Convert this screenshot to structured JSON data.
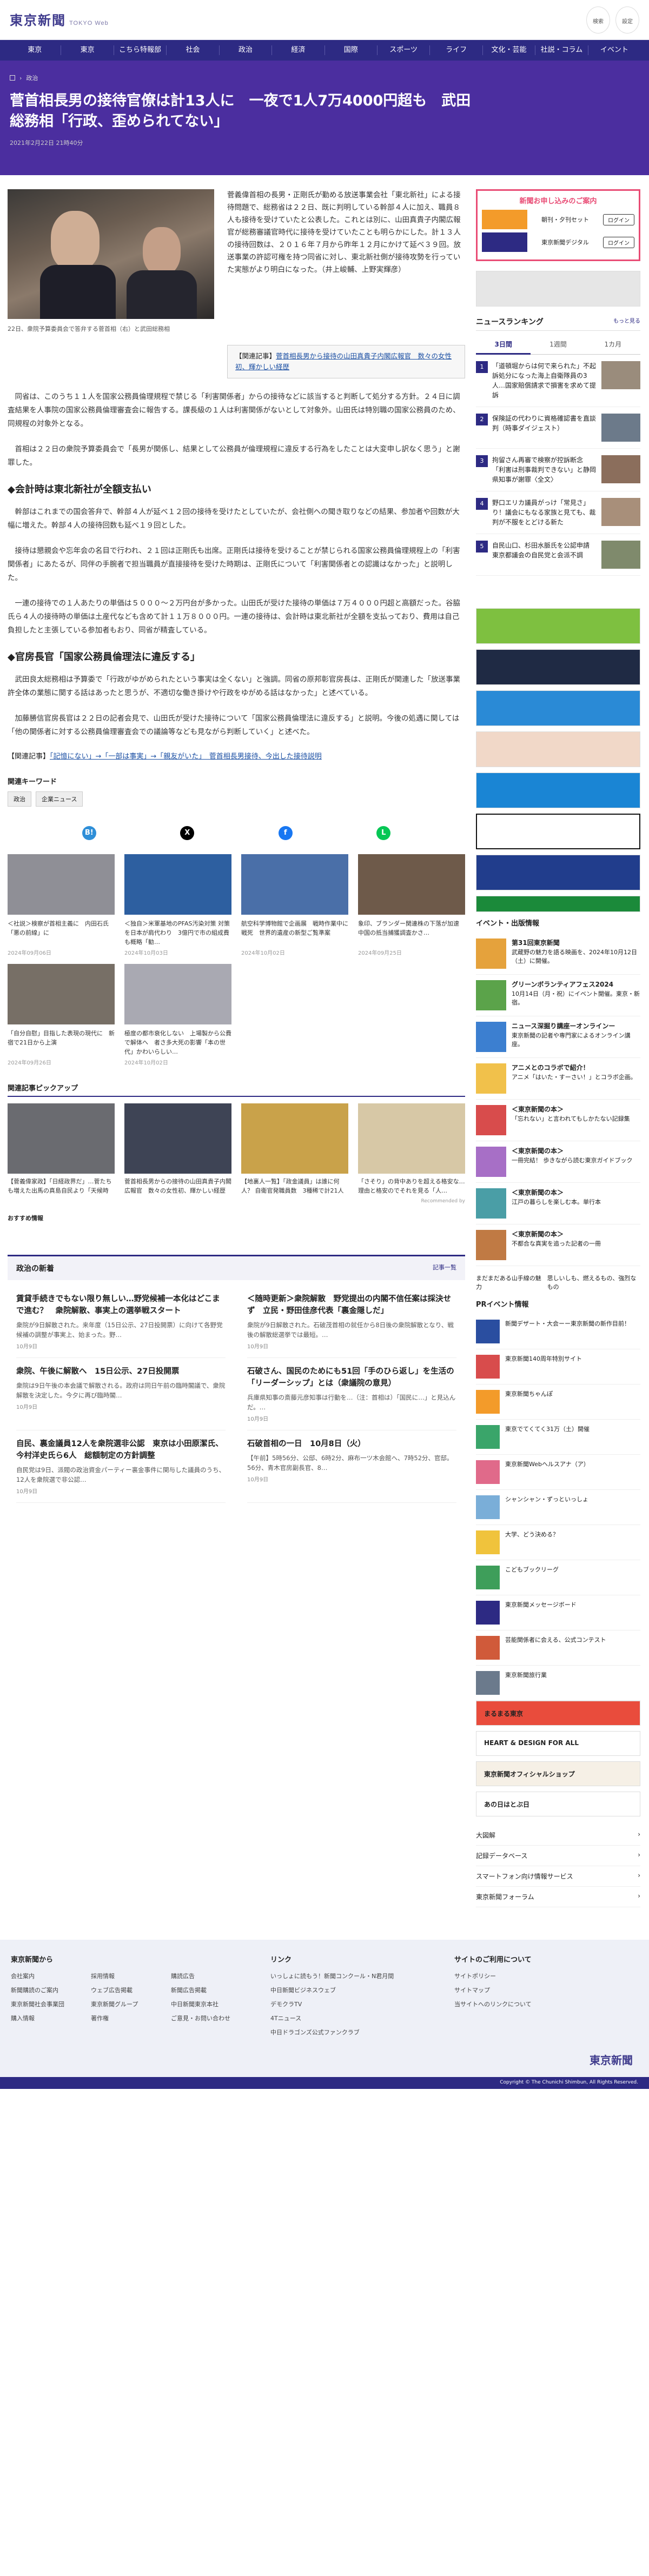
{
  "header": {
    "logo": "東京新聞",
    "logo_sub": "TOKYO Web",
    "btn1": "検索",
    "btn2": "設定"
  },
  "nav": [
    "東京",
    "東京",
    "こちら特報部",
    "社会",
    "政治",
    "経済",
    "国際",
    "スポーツ",
    "ライフ",
    "文化・芸能",
    "社説・コラム",
    "イベント"
  ],
  "hero": {
    "crumb": "政治",
    "title": "菅首相長男の接待官僚は計13人に　一夜で1人7万4000円超も　武田総務相「行政、歪められてない」",
    "date": "2021年2月22日 21時40分"
  },
  "article": {
    "lead": "菅義偉首相の長男・正剛氏が勤める放送事業会社「東北新社」による接待問題で、総務省は２２日、既に判明している幹部４人に加え、職員８人も接待を受けていたと公表した。これとは別に、山田真貴子内閣広報官が総務審議官時代に接待を受けていたことも明らかにした。計１３人の接待回数は、２０１６年７月から昨年１２月にかけて延べ３９回。放送事業の許認可権を持つ同省に対し、東北新社側が接待攻勢を行っていた実態がより明白になった。（井上峻輔、上野実輝彦）",
    "caption": "22日、衆院予算委員会で答弁する菅首相（右）と武田総務相",
    "related_label": "【関連記事】",
    "related_link": "菅首相長男から接待の山田真貴子内閣広報官　数々の女性初、輝かしい経歴",
    "p1": "同省は、このうち１１人を国家公務員倫理規程で禁じる「利害関係者」からの接待などに該当すると判断して処分する方針。２４日に調査結果を人事院の国家公務員倫理審査会に報告する。課長級の１人は利害関係がないとして対象外。山田氏は特別職の国家公務員のため、同規程の対象外となる。",
    "p2": "首相は２２日の衆院予算委員会で「長男が関係し、結果として公務員が倫理規程に違反する行為をしたことは大変申し訳なく思う」と謝罪した。",
    "h1": "◆会計時は東北新社が全額支払い",
    "p3": "幹部はこれまでの国会答弁で、幹部４人が延べ１２回の接待を受けたとしていたが、会社側への聞き取りなどの結果、参加者や回数が大幅に増えた。幹部４人の接待回数も延べ１９回とした。",
    "p4": "接待は懇親会や忘年会の名目で行われ、２１回は正剛氏も出席。正剛氏は接待を受けることが禁じられる国家公務員倫理規程上の「利害関係者」にあたるが、同伴の手腕者で担当職員が直接接待を受けた時期は、正剛氏について「利害関係者との認識はなかった」と説明した。",
    "p5": "一連の接待での１人あたりの単価は５０００〜２万円台が多かった。山田氏が受けた接待の単価は７万４０００円超と高額だった。谷脇氏ら４人の接待時の単価は土産代なども含めて計１１万８０００円。一連の接待は、会計時は東北新社が全額を支払っており、費用は自己負担したと主張している参加者もおり、同省が精査している。",
    "h2": "◆官房長官「国家公務員倫理法に違反する」",
    "p6": "武田良太総務相は予算委で「行政がゆがめられたという事実は全くない」と強調。同省の原邦彰官房長は、正剛氏が関連した「放送事業許全体の業態に関する話はあったと思うが、不適切な働き掛けや行政をゆがめる話はなかった」と述べている。",
    "p7": "加藤勝信官房長官は２２日の記者会見で、山田氏が受けた接待について「国家公務員倫理法に違反する」と説明。今後の処遇に関しては「他の関係者に対する公務員倫理審査会での議論等なども見ながら判断していく」と述べた。",
    "rel2_label": "【関連記事】",
    "rel2_links": "「記憶にない」→「一部は事実」→「親友がいた」　菅首相長男接待、今出した接待説明"
  },
  "keywords": {
    "title": "関連キーワード",
    "tags": [
      "政治",
      "企業ニュース"
    ]
  },
  "share": [
    "B!",
    "X",
    "f",
    "L"
  ],
  "cards": [
    {
      "t": "＜社説＞検察が首相主義に　内田石氏「悪の前線」に",
      "d": "2024年09月06日"
    },
    {
      "t": "＜独自＞米軍基地のPFAS汚染対策 対策を日本が肩代わり　3億円で市の組成費も概略「勧…",
      "d": "2024年10月03日"
    },
    {
      "t": "航空科学博物館で企画展　戦時作業中に戦死　世界的遺産の新型ご覧準案",
      "d": "2024年10月02日"
    },
    {
      "t": "象印、ブランダー関連株の下落が加速　中国の抵当捕獲調査かさ…",
      "d": "2024年09月25日"
    },
    {
      "t": "「自分自慰」目指した表現の現代に　新宿で21日から上演",
      "d": "2024年09月26日"
    },
    {
      "t": "極度の都市衰化しない　上場製から公費で解体へ　者さ多大死の影響「本の世代」かわいらしい…",
      "d": "2024年10月02日"
    }
  ],
  "pickup": {
    "title": "関連記事ピックアップ",
    "items": [
      "【菅義偉家政】「日経政界だ」…菅たちも増えた出馬の真島自民より「天候時代」の政…",
      "菅首相長男からの接待の山田真貴子内閣広報官　数々の女性初、輝かしい経歴",
      "【地裏人一覧】「政金議員」は誰に何人？ 自衛官発職員数　3種稀で計21人　政治改革への…",
      "「さそり」の背中ありを超える格安な…理由と格安のでそれを見る「人…"
    ],
    "credit": "Recommended by"
  },
  "osusume": "おすすめ情報",
  "news": {
    "title": "政治の新着",
    "more": "記事一覧",
    "items": [
      {
        "h": "賃貸手続きでもない限り無しい…野党候補一本化はどこまで進む？　衆院解散、事実上の選挙戦スタート",
        "p": "衆院が9日解散された。来年度（15日公示、27日投開票）に向けて各野党候補の調整が事実上、始まった。野…",
        "d": "10月9日"
      },
      {
        "h": "＜随時更新＞衆院解散　野党提出の内閣不信任案は採決せず　立民・野田佳彦代表「裏金隠しだ」",
        "p": "衆院が9日解散された。石破茂首相の就任から8日後の衆院解散となり、戦後の解散総選挙では最短。…",
        "d": "10月9日"
      },
      {
        "h": "衆院、午後に解散へ　15日公示、27日投開票",
        "p": "衆院は9日午後の本会議で解散される。政府は同日午前の臨時閣議で、衆院解散を決定した。今夕に再び臨時閣…",
        "d": "10月9日"
      },
      {
        "h": "石破さん、国民のためにも51回「手のひら返し」を生活の「リーダーシップ」とは（衆議院の意見）",
        "p": "兵庫県知事の斎藤元彦知事は行動を…（注：首相は）「国民に…」と見込んだ。…",
        "d": "10月9日"
      },
      {
        "h": "自民、裏金議員12人を衆院選非公認　東京は小田原潔氏、今村洋史氏ら6人　総額制定の方針調整",
        "p": "自民党は9日、派閥の政治資金パーティー裏金事件に関与した議員のうち、12人を衆院選で非公認…",
        "d": "10月9日"
      },
      {
        "h": "石破首相の一日　10月8日（火）",
        "p": "【午前】5時56分、公邸、6時2分、麻布一ツ木会館へ、7時52分、官邸。56分、青木官房副長官、8…",
        "d": "10月9日"
      }
    ]
  },
  "sidebar": {
    "subs_title": "新聞お申し込みのご案内",
    "subs": [
      {
        "n": "朝刊・夕刊セット",
        "b": "ログイン"
      },
      {
        "n": "東京新聞デジタル",
        "b": "ログイン"
      }
    ],
    "rank_title": "ニュースランキング",
    "rank_more": "もっと見る",
    "rank_tabs": [
      "3日間",
      "1週間",
      "1カ月"
    ],
    "rank": [
      "「道頓堀からは何で来られた」不起訴処分になった海上自衛隊員の3人…国家賠償請求で損害を求めて提訴",
      "保険証の代わりに資格確認書を直談判（時事ダイジェスト）",
      "拘留さん再審で検察が控訴断念　「利害は刑事裁判できない」と静岡県知事が謝罪〈全文〉",
      "野口エリカ議員がっけ「常見さ」り！議会にもなる家族と見ても、裁判が不服をとどける新た",
      "自民山口、杉田水脈氏を公認申請　東京都議会の自民党と会派不調"
    ],
    "ev_title": "イベント・出版情報",
    "events": [
      {
        "b": "第31回東京新聞",
        "t": "武蔵野の魅力を語る映画を、2024年10月12日（土）に開催。"
      },
      {
        "b": "グリーンボランティアフェス2024",
        "t": "10月14日（月・祝）にイベント開催。東京・新宿。"
      },
      {
        "b": "ニュース深掘り講座ーオンラインー",
        "t": "東京新聞の記者や専門家によるオンライン講座。"
      },
      {
        "b": "アニメとのコラボで紹介！",
        "t": "アニメ「はいた・すーさい！」とコラボ企画。"
      },
      {
        "b": "＜東京新聞の本＞",
        "t": "「忘れない」と言われてもしかたない記録集"
      },
      {
        "b": "＜東京新聞の本＞",
        "t": "一冊完結！ 歩きながら読む東京ガイドブック"
      },
      {
        "b": "＜東京新聞の本＞",
        "t": "江戸の暮らしを楽しむ本。単行本"
      },
      {
        "b": "＜東京新聞の本＞",
        "t": "不都合な真実を追った記者の一冊"
      }
    ],
    "cols": [
      "まだまだある山手線の魅力",
      "思しいしも、燃えるもの、強烈なもの"
    ],
    "pr_title": "PRイベント情報",
    "pr": [
      "新聞デザート・大会ーー東京新聞の新作目前！",
      "東京新聞140周年特別サイト",
      "東京新聞ちゃんぽ",
      "東京でてくてく31万（土）開催",
      "東京新聞Webヘルスアナ（ア）",
      "シャンシャン・ずっといっしょ",
      "大学、どう決める？",
      "こどもブックリーグ",
      "東京新聞メッセージボード",
      "芸能関係者に会える、公式コンテスト",
      "東京新聞旅行業",
      "まるまる東京",
      "HEART & DESIGN FOR ALL",
      "東京新聞オフィシャルショップ",
      "あの日はとぶ日"
    ],
    "links": [
      "大図解",
      "記録データベース",
      "スマートフォン向け情報サービス",
      "東京新聞フォーラム"
    ]
  },
  "footer": {
    "c1_title": "東京新聞から",
    "c1": [
      "会社案内",
      "採用情報",
      "購読広告",
      "新聞購読のご案内",
      "ウェブ広告掲載",
      "新聞広告掲載",
      "東京新聞社会事業団",
      "東京新聞グループ",
      "中日新聞東京本社",
      "購入情報",
      "著作権",
      "ご意見・お問い合わせ"
    ],
    "c2_title": "リンク",
    "c2": [
      "いっしょに読もう！新聞コンクール・N君月間",
      "中日新聞ビジネスウェブ",
      "デモクラTV",
      "4Tニュース",
      "中日ドラゴンズ公式ファンクラブ"
    ],
    "c3_title": "サイトのご利用について",
    "c3": [
      "サイトポリシー",
      "サイトマップ",
      "当サイトへのリンクについて"
    ],
    "logo": "東京新聞",
    "copyright": "Copyright © The Chunichi Shimbun, All Rights Reserved."
  }
}
